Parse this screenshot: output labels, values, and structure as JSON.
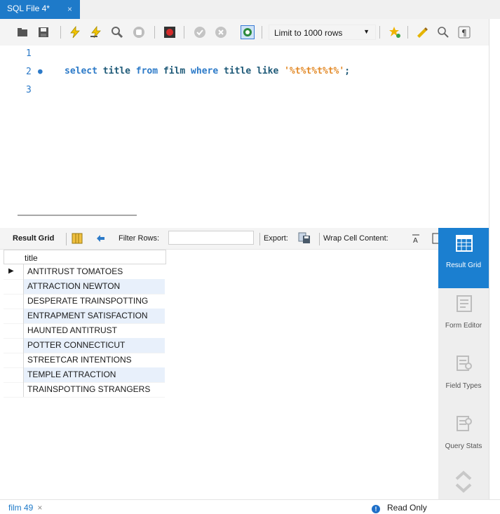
{
  "tab": {
    "title": "SQL File 4*",
    "close": "×"
  },
  "toolbar": {
    "limit_label": "Limit to 1000 rows",
    "icons": [
      "folder-icon",
      "save-icon",
      "execute-icon",
      "execute-current-icon",
      "explain-icon",
      "stop-icon",
      "toggle-error-icon",
      "commit-icon",
      "rollback-icon",
      "autocommit-icon",
      "bookmark-icon",
      "beautify-icon",
      "find-icon",
      "invisible-chars-icon"
    ]
  },
  "editor": {
    "line_numbers": [
      "1",
      "2",
      "3"
    ],
    "code": {
      "kw_select": "select",
      "col": " title ",
      "kw_from": "from",
      "table": " film ",
      "kw_where": "where",
      "col2": " title like ",
      "str": "'%t%t%t%t%'",
      "semi": ";"
    }
  },
  "results_toolbar": {
    "result_grid": "Result Grid",
    "filter_rows": "Filter Rows:",
    "export": "Export:",
    "wrap": "Wrap Cell Content:"
  },
  "grid": {
    "header": "title",
    "rows": [
      "ANTITRUST TOMATOES",
      "ATTRACTION NEWTON",
      "DESPERATE TRAINSPOTTING",
      "ENTRAPMENT SATISFACTION",
      "HAUNTED ANTITRUST",
      "POTTER CONNECTICUT",
      "STREETCAR INTENTIONS",
      "TEMPLE ATTRACTION",
      "TRAINSPOTTING STRANGERS"
    ]
  },
  "sidebar": [
    {
      "label": "Result Grid",
      "active": true
    },
    {
      "label": "Form Editor",
      "active": false
    },
    {
      "label": "Field Types",
      "active": false
    },
    {
      "label": "Query Stats",
      "active": false
    }
  ],
  "status": {
    "tab": "film 49",
    "close": "×",
    "readonly": "Read Only"
  },
  "colors": {
    "accent": "#1e7ac9",
    "keyword": "#2c7ac8",
    "string": "#e38b2a",
    "row_alt": "#e8f0fb"
  }
}
